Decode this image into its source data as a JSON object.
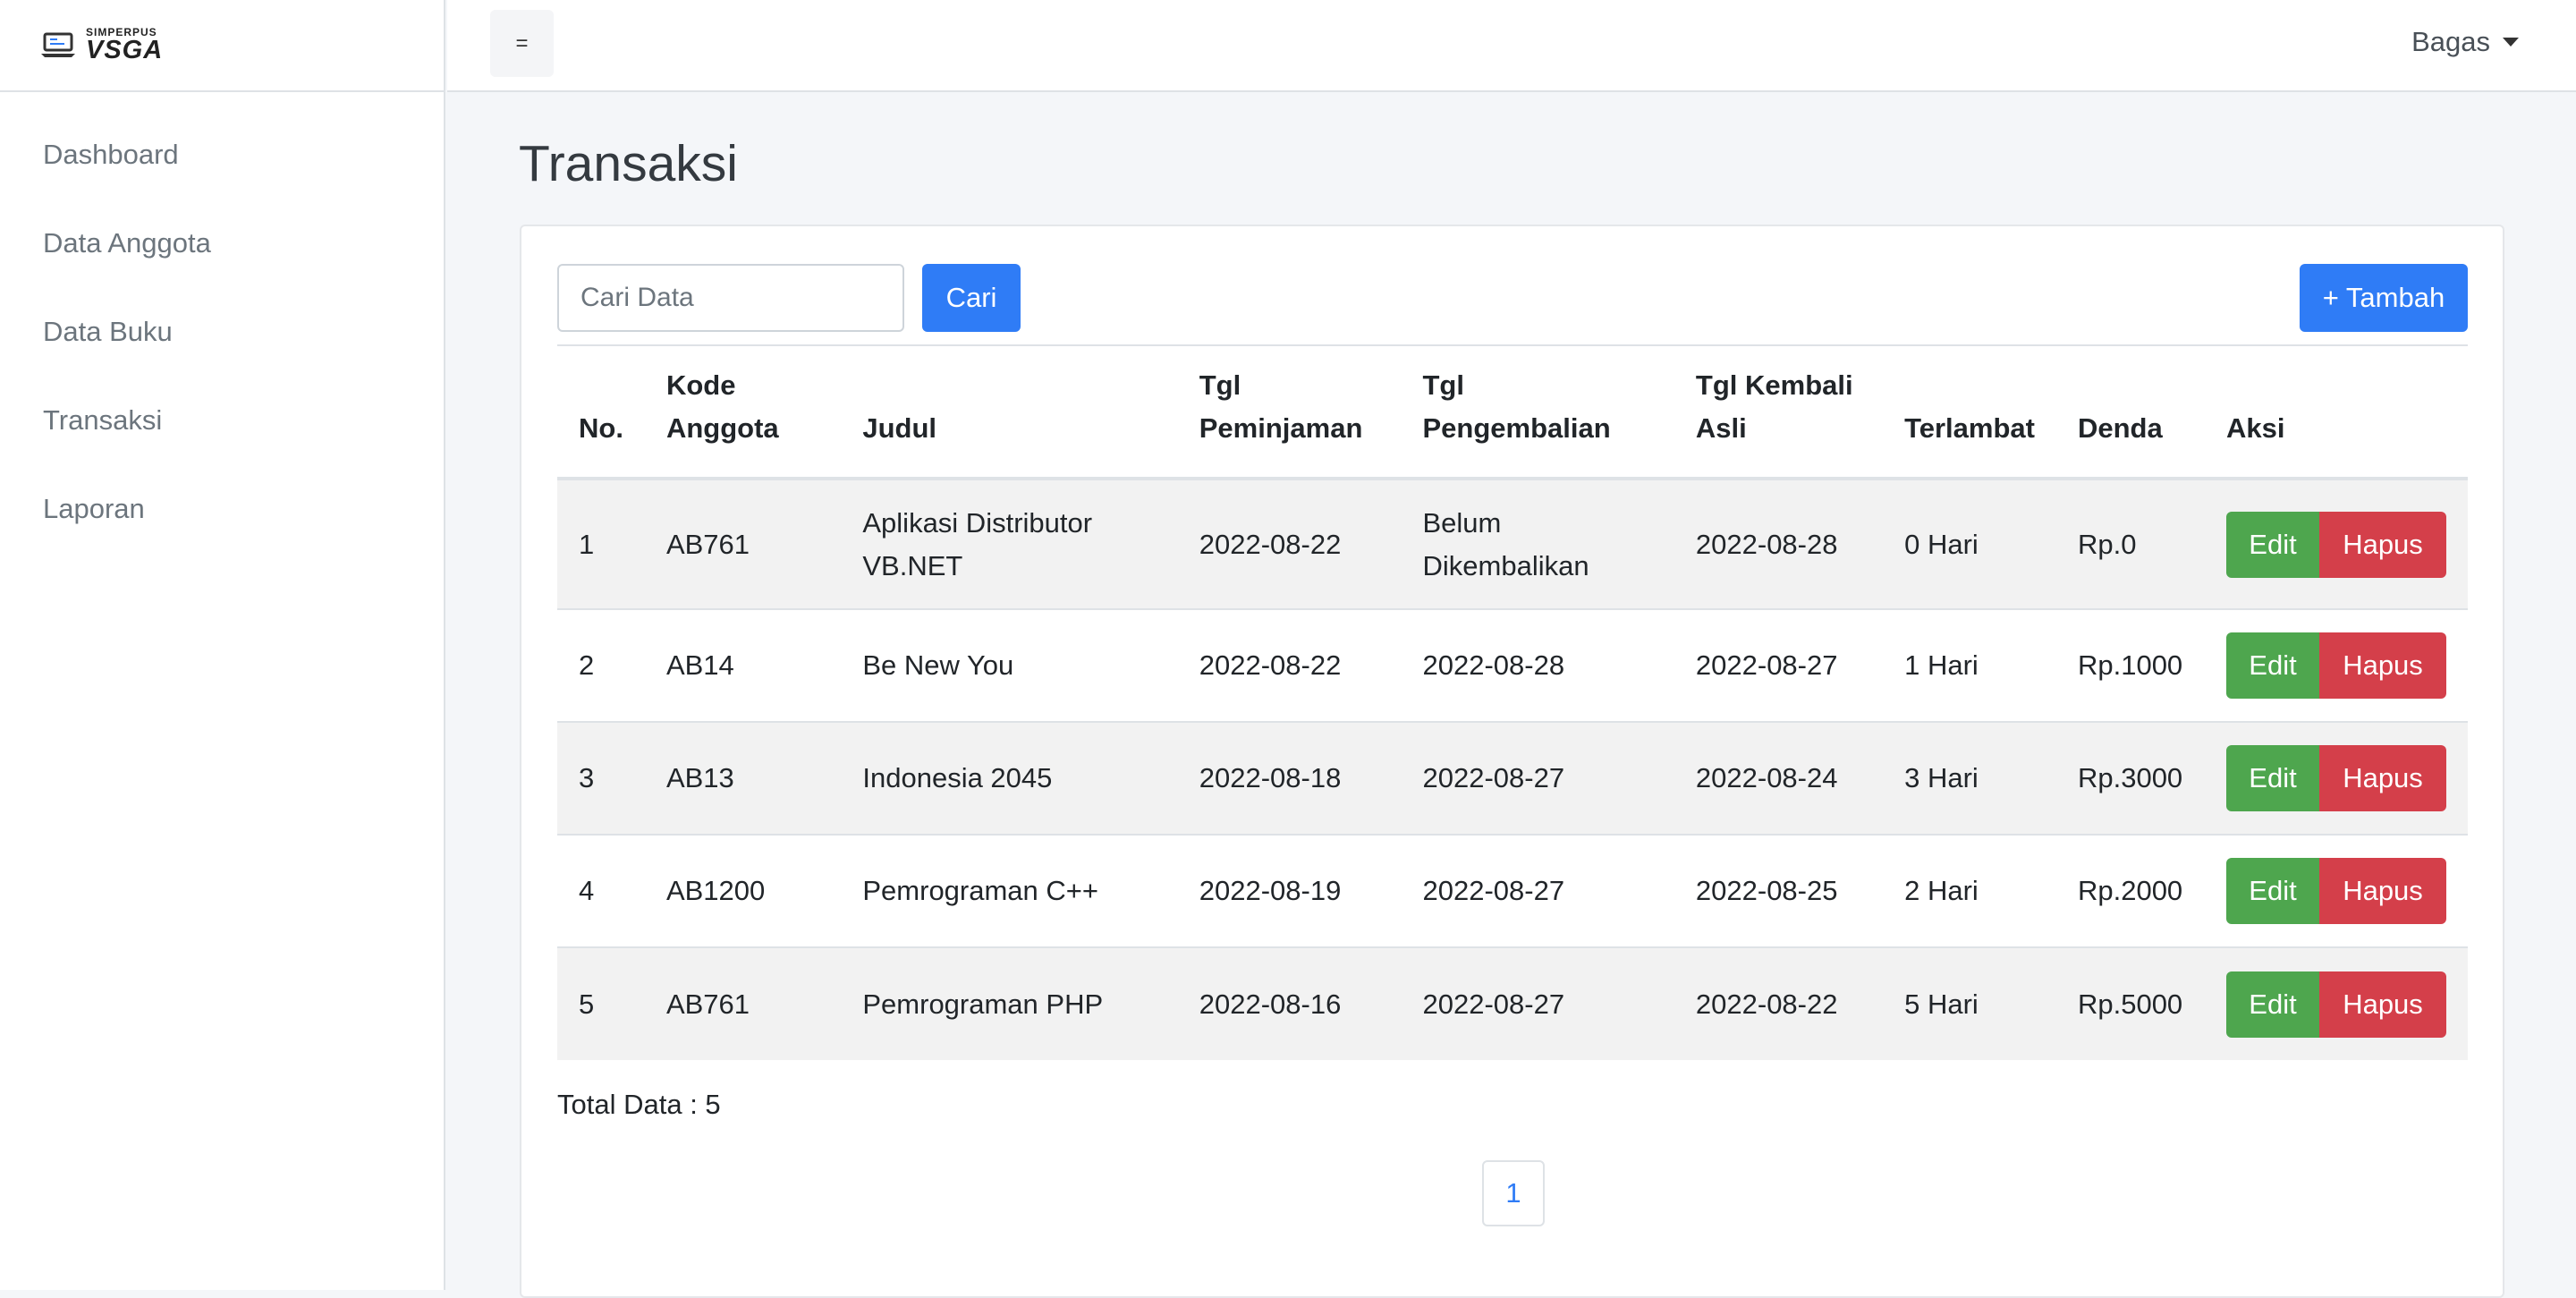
{
  "brand": {
    "small": "SIMPERPUS",
    "big": "VSGA"
  },
  "sidebar": {
    "items": [
      {
        "label": "Dashboard"
      },
      {
        "label": "Data Anggota"
      },
      {
        "label": "Data Buku"
      },
      {
        "label": "Transaksi"
      },
      {
        "label": "Laporan"
      }
    ]
  },
  "topbar": {
    "toggle_label": "=",
    "user": "Bagas"
  },
  "page": {
    "title": "Transaksi"
  },
  "search": {
    "placeholder": "Cari Data",
    "button": "Cari"
  },
  "add_button": "+ Tambah",
  "table": {
    "headers": {
      "no": "No.",
      "kode_1": "Kode",
      "kode_2": "Anggota",
      "judul": "Judul",
      "tgl_pinjam_1": "Tgl",
      "tgl_pinjam_2": "Peminjaman",
      "tgl_kembali": "Tgl Pengembalian",
      "tgl_asli_1": "Tgl Kembali",
      "tgl_asli_2": "Asli",
      "terlambat": "Terlambat",
      "denda": "Denda",
      "aksi": "Aksi"
    },
    "rows": [
      {
        "no": "1",
        "kode": "AB761",
        "judul_1": "Aplikasi Distributor",
        "judul_2": "VB.NET",
        "tgl_pinjam": "2022-08-22",
        "kembali_1": "Belum",
        "kembali_2": "Dikembalikan",
        "tgl_asli": "2022-08-28",
        "terlambat": "0 Hari",
        "denda": "Rp.0"
      },
      {
        "no": "2",
        "kode": "AB14",
        "judul": "Be New You",
        "tgl_pinjam": "2022-08-22",
        "kembali": "2022-08-28",
        "tgl_asli": "2022-08-27",
        "terlambat": "1 Hari",
        "denda": "Rp.1000"
      },
      {
        "no": "3",
        "kode": "AB13",
        "judul": "Indonesia 2045",
        "tgl_pinjam": "2022-08-18",
        "kembali": "2022-08-27",
        "tgl_asli": "2022-08-24",
        "terlambat": "3 Hari",
        "denda": "Rp.3000"
      },
      {
        "no": "4",
        "kode": "AB1200",
        "judul": "Pemrograman C++",
        "tgl_pinjam": "2022-08-19",
        "kembali": "2022-08-27",
        "tgl_asli": "2022-08-25",
        "terlambat": "2 Hari",
        "denda": "Rp.2000"
      },
      {
        "no": "5",
        "kode": "AB761",
        "judul": "Pemrograman PHP",
        "tgl_pinjam": "2022-08-16",
        "kembali": "2022-08-27",
        "tgl_asli": "2022-08-22",
        "terlambat": "5 Hari",
        "denda": "Rp.5000"
      }
    ],
    "edit_label": "Edit",
    "hapus_label": "Hapus"
  },
  "total_text": "Total Data : 5",
  "pagination": {
    "current": "1"
  },
  "colors": {
    "primary": "#2f7cf6",
    "success": "#4ea64e",
    "danger": "#d43f4a"
  }
}
